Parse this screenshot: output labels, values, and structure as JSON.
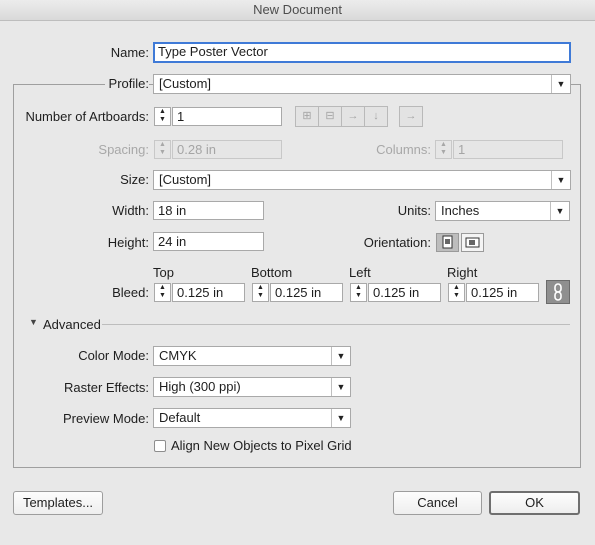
{
  "window": {
    "title": "New Document"
  },
  "name": {
    "label": "Name:",
    "value": "Type Poster Vector"
  },
  "profile": {
    "label": "Profile:",
    "value": "[Custom]"
  },
  "artboards": {
    "label": "Number of Artboards:",
    "value": "1"
  },
  "spacing": {
    "label": "Spacing:",
    "value": "0.28 in"
  },
  "columns": {
    "label": "Columns:",
    "value": "1"
  },
  "size": {
    "label": "Size:",
    "value": "[Custom]"
  },
  "width": {
    "label": "Width:",
    "value": "18 in"
  },
  "units": {
    "label": "Units:",
    "value": "Inches"
  },
  "height": {
    "label": "Height:",
    "value": "24 in"
  },
  "orientation": {
    "label": "Orientation:",
    "selected": "portrait"
  },
  "bleed": {
    "label": "Bleed:",
    "top": {
      "label": "Top",
      "value": "0.125 in"
    },
    "bottom": {
      "label": "Bottom",
      "value": "0.125 in"
    },
    "left": {
      "label": "Left",
      "value": "0.125 in"
    },
    "right": {
      "label": "Right",
      "value": "0.125 in"
    }
  },
  "advanced": {
    "label": "Advanced",
    "color_mode": {
      "label": "Color Mode:",
      "value": "CMYK"
    },
    "raster_effects": {
      "label": "Raster Effects:",
      "value": "High (300 ppi)"
    },
    "preview_mode": {
      "label": "Preview Mode:",
      "value": "Default"
    },
    "align_pixel_grid": {
      "label": "Align New Objects to Pixel Grid",
      "checked": false
    }
  },
  "buttons": {
    "templates": "Templates...",
    "cancel": "Cancel",
    "ok": "OK"
  },
  "icons": {
    "spinner": "up-down-arrows-icon",
    "artboard_layouts": [
      "grid-by-row-icon",
      "grid-by-column-icon",
      "arrange-by-row-icon",
      "arrange-by-column-icon",
      "right-to-left-icon"
    ],
    "bleed_link": "chain-link-icon"
  }
}
